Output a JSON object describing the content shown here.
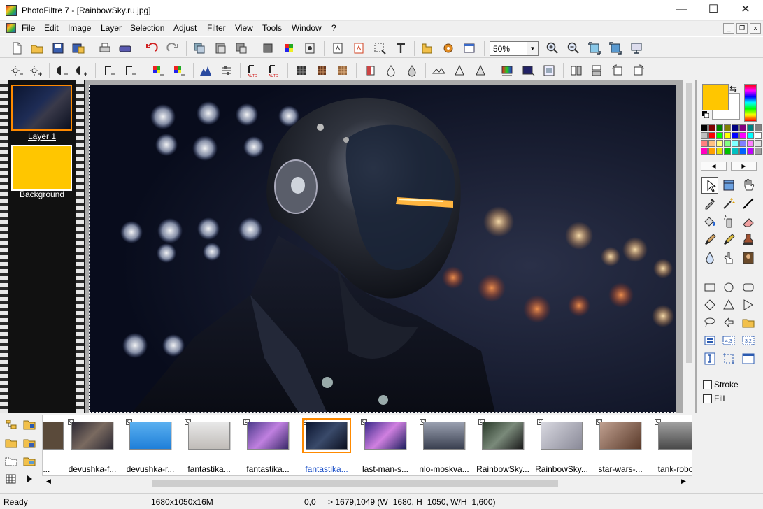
{
  "window": {
    "title": "PhotoFiltre 7 - [RainbowSky.ru.jpg]",
    "minimize": "—",
    "maximize": "☐",
    "close": "✕"
  },
  "menu": {
    "items": [
      "File",
      "Edit",
      "Image",
      "Layer",
      "Selection",
      "Adjust",
      "Filter",
      "View",
      "Tools",
      "Window",
      "?"
    ]
  },
  "mdi_controls": {
    "minimize": "_",
    "restore": "❐",
    "close": "x"
  },
  "toolbar": {
    "zoom_value": "50%"
  },
  "layers": {
    "items": [
      {
        "label": "Layer 1"
      },
      {
        "label": "Background"
      }
    ]
  },
  "colors": {
    "foreground": "#FFC600",
    "background": "#FFFFFF",
    "selection_accent": "#FF8A00",
    "selected_text": "#1A4FC8"
  },
  "options": {
    "stroke_label": "Stroke",
    "fill_label": "Fill"
  },
  "browser": {
    "thumbnails": [
      {
        "name": "rn...",
        "thumb": "#5a4a3a"
      },
      {
        "name": "devushka-f...",
        "thumb": "#2d2a34"
      },
      {
        "name": "devushka-r...",
        "thumb": "#1f7fd8"
      },
      {
        "name": "fantastika...",
        "thumb": "#d6d4d0"
      },
      {
        "name": "fantastika...",
        "thumb": "#6a4a9a"
      },
      {
        "name": "fantastika...",
        "thumb": "#1a2540",
        "selected": true
      },
      {
        "name": "last-man-s...",
        "thumb": "#8a5ad0"
      },
      {
        "name": "nlo-moskva...",
        "thumb": "#4a5060"
      },
      {
        "name": "RainbowSky...",
        "thumb": "#3a4a3a"
      },
      {
        "name": "RainbowSky...",
        "thumb": "#b8b8c0"
      },
      {
        "name": "star-wars-...",
        "thumb": "#8a6a5a"
      },
      {
        "name": "tank-robo...",
        "thumb": "#6a6a6a"
      }
    ]
  },
  "status": {
    "state": "Ready",
    "image_info": "1680x1050x16M",
    "coords": "0,0 ==> 1679,1049 (W=1680, H=1050, W/H=1,600)"
  }
}
